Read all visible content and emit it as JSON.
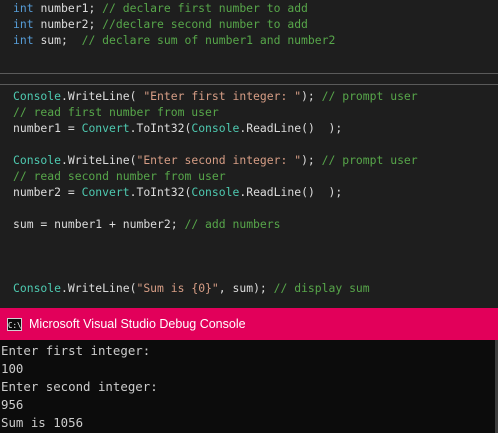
{
  "code_top": [
    [
      [
        "kw",
        "int"
      ],
      [
        "p",
        " "
      ],
      [
        "id",
        "number1"
      ],
      [
        "p",
        "; "
      ],
      [
        "cm",
        "// declare first number to add"
      ]
    ],
    [
      [
        "kw",
        "int"
      ],
      [
        "p",
        " "
      ],
      [
        "id",
        "number2"
      ],
      [
        "p",
        "; "
      ],
      [
        "cm",
        "//declare second number to add"
      ]
    ],
    [
      [
        "kw",
        "int"
      ],
      [
        "p",
        " "
      ],
      [
        "id",
        "sum"
      ],
      [
        "p",
        ";  "
      ],
      [
        "cm",
        "// declare sum of number1 and number2"
      ]
    ]
  ],
  "code_bottom": [
    [
      [
        "type",
        "Console"
      ],
      [
        "p",
        "."
      ],
      [
        "method",
        "WriteLine"
      ],
      [
        "p",
        "( "
      ],
      [
        "str",
        "\"Enter first integer: \""
      ],
      [
        "p",
        "); "
      ],
      [
        "cm",
        "// prompt user"
      ]
    ],
    [
      [
        "cm",
        "// read first number from user"
      ]
    ],
    [
      [
        "id",
        "number1"
      ],
      [
        "p",
        " = "
      ],
      [
        "type",
        "Convert"
      ],
      [
        "p",
        "."
      ],
      [
        "method",
        "ToInt32"
      ],
      [
        "p",
        "("
      ],
      [
        "type",
        "Console"
      ],
      [
        "p",
        "."
      ],
      [
        "method",
        "ReadLine"
      ],
      [
        "p",
        "()  );"
      ]
    ],
    [],
    [
      [
        "type",
        "Console"
      ],
      [
        "p",
        "."
      ],
      [
        "method",
        "WriteLine"
      ],
      [
        "p",
        "("
      ],
      [
        "str",
        "\"Enter second integer: \""
      ],
      [
        "p",
        "); "
      ],
      [
        "cm",
        "// prompt user"
      ]
    ],
    [
      [
        "cm",
        "// read second number from user"
      ]
    ],
    [
      [
        "id",
        "number2"
      ],
      [
        "p",
        " = "
      ],
      [
        "type",
        "Convert"
      ],
      [
        "p",
        "."
      ],
      [
        "method",
        "ToInt32"
      ],
      [
        "p",
        "("
      ],
      [
        "type",
        "Console"
      ],
      [
        "p",
        "."
      ],
      [
        "method",
        "ReadLine"
      ],
      [
        "p",
        "()  );"
      ]
    ],
    [],
    [
      [
        "id",
        "sum"
      ],
      [
        "p",
        " = "
      ],
      [
        "id",
        "number1"
      ],
      [
        "p",
        " + "
      ],
      [
        "id",
        "number2"
      ],
      [
        "p",
        "; "
      ],
      [
        "cm",
        "// add numbers"
      ]
    ],
    [],
    [],
    [],
    [
      [
        "type",
        "Console"
      ],
      [
        "p",
        "."
      ],
      [
        "method",
        "WriteLine"
      ],
      [
        "p",
        "("
      ],
      [
        "str",
        "\"Sum is {0}\""
      ],
      [
        "p",
        ", "
      ],
      [
        "id",
        "sum"
      ],
      [
        "p",
        "); "
      ],
      [
        "cm",
        "// display sum"
      ]
    ]
  ],
  "console": {
    "title": "Microsoft Visual Studio Debug Console",
    "icon_label": "C:\\",
    "icon": "console-window-icon",
    "title_color": "#e2005a",
    "output": [
      "Enter first integer:",
      "100",
      "Enter second integer:",
      "956",
      "Sum is 1056"
    ]
  },
  "colors": {
    "editor_bg": "#1e1e1e",
    "keyword": "#569cd6",
    "type": "#4ec9b0",
    "string": "#d69d85",
    "comment": "#57a64a",
    "text": "#dcdcdc"
  }
}
